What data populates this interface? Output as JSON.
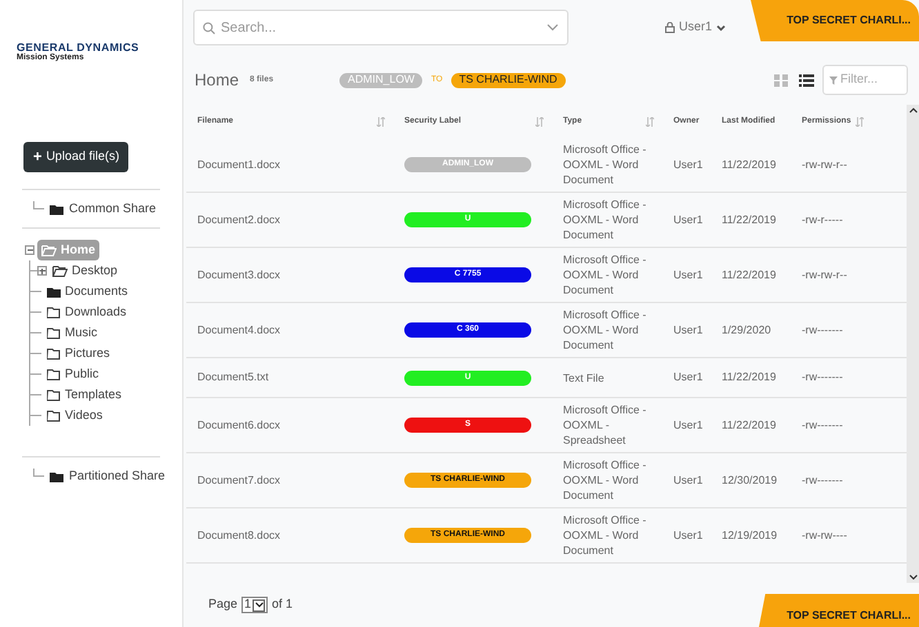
{
  "logo": {
    "title": "GENERAL DYNAMICS",
    "subtitle": "Mission Systems"
  },
  "upload_button": {
    "icon": "+",
    "label": "Upload file(s)"
  },
  "sidebar": {
    "common_share": {
      "label": "Common Share",
      "kind": "filled"
    },
    "tree": [
      {
        "label": "Home",
        "kind": "open",
        "selected": true,
        "expanded": true,
        "children": [
          {
            "label": "Desktop",
            "kind": "open",
            "selected": false,
            "expanded": false
          },
          {
            "label": "Documents",
            "kind": "filled",
            "selected": false
          },
          {
            "label": "Downloads",
            "kind": "outline",
            "selected": false
          },
          {
            "label": "Music",
            "kind": "outline",
            "selected": false
          },
          {
            "label": "Pictures",
            "kind": "outline",
            "selected": false
          },
          {
            "label": "Public",
            "kind": "outline",
            "selected": false
          },
          {
            "label": "Templates",
            "kind": "outline",
            "selected": false
          },
          {
            "label": "Videos",
            "kind": "outline",
            "selected": false
          }
        ]
      }
    ],
    "partitioned_share": {
      "label": "Partitioned Share",
      "kind": "filled"
    }
  },
  "search": {
    "placeholder": "Search..."
  },
  "user_menu": {
    "label": "User1"
  },
  "classification_banner_top": "TOP SECRET CHARLI...",
  "header": {
    "title": "Home",
    "count": "8 files",
    "range_from": "ADMIN_LOW",
    "range_to_word": "TO",
    "range_to": "TS CHARLIE-WIND",
    "view_modes": [
      {
        "kind": "grid",
        "selected": false
      },
      {
        "kind": "list",
        "selected": true
      }
    ],
    "filter_placeholder": "Filter..."
  },
  "table": {
    "columns": [
      "Filename",
      "Security Label",
      "Type",
      "Owner",
      "Last Modified",
      "Permissions"
    ],
    "rows": [
      {
        "filename": "Document1.docx",
        "label": "ADMIN_LOW",
        "color": "#bdbdbd",
        "type": "Microsoft Office - OOXML - Word Document",
        "owner": "User1",
        "modified": "11/22/2019",
        "permissions": "-rw-rw-r--"
      },
      {
        "filename": "Document2.docx",
        "label": "U",
        "color": "#22ee22",
        "type": "Microsoft Office - OOXML - Word Document",
        "owner": "User1",
        "modified": "11/22/2019",
        "permissions": "-rw-r-----"
      },
      {
        "filename": "Document3.docx",
        "label": "C 7755",
        "color": "#0a0ae6",
        "type": "Microsoft Office - OOXML - Word Document",
        "owner": "User1",
        "modified": "11/22/2019",
        "permissions": "-rw-rw-r--"
      },
      {
        "filename": "Document4.docx",
        "label": "C 360",
        "color": "#0a0ae6",
        "type": "Microsoft Office - OOXML - Word Document",
        "owner": "User1",
        "modified": "1/29/2020",
        "permissions": "-rw-------"
      },
      {
        "filename": "Document5.txt",
        "label": "U",
        "color": "#22ee22",
        "type": "Text File",
        "owner": "User1",
        "modified": "11/22/2019",
        "permissions": "-rw-------"
      },
      {
        "filename": "Document6.docx",
        "label": "S",
        "color": "#ee1111",
        "type": "Microsoft Office - OOXML - Spreadsheet",
        "owner": "User1",
        "modified": "11/22/2019",
        "permissions": "-rw-------"
      },
      {
        "filename": "Document7.docx",
        "label": "TS CHARLIE-WIND",
        "color": "#f5a60a",
        "type": "Microsoft Office - OOXML - Word Document",
        "owner": "User1",
        "modified": "12/30/2019",
        "permissions": "-rw-------"
      },
      {
        "filename": "Document8.docx",
        "label": "TS CHARLIE-WIND",
        "color": "#f5a60a",
        "type": "Microsoft Office - OOXML - Word Document",
        "owner": "User1",
        "modified": "12/19/2019",
        "permissions": "-rw-rw----"
      }
    ]
  },
  "pagination": {
    "prefix": "Page",
    "page": "1",
    "suffix": "of 1"
  },
  "classification_banner_bottom": "TOP SECRET CHARLI..."
}
